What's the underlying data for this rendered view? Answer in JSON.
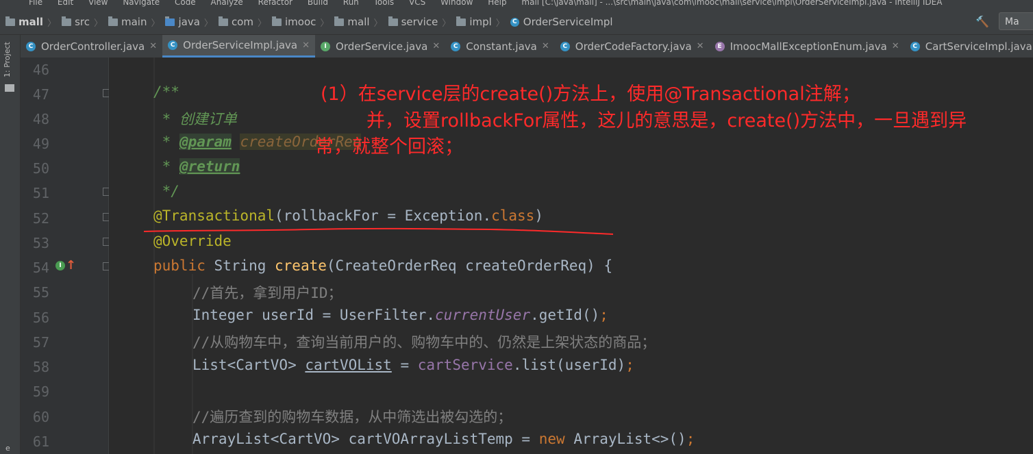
{
  "menu": [
    "File",
    "Edit",
    "View",
    "Navigate",
    "Code",
    "Analyze",
    "Refactor",
    "Build",
    "Run",
    "Tools",
    "VCS",
    "Window",
    "Help",
    "mall [C:\\java\\mall] - ...\\src\\main\\java\\com\\imooc\\mall\\service\\impl\\OrderServiceImpl.java - IntelliJ IDEA"
  ],
  "breadcrumb": [
    "mall",
    "src",
    "main",
    "java",
    "com",
    "imooc",
    "mall",
    "service",
    "impl",
    "OrderServiceImpl"
  ],
  "run_label": "Ma",
  "tabs": [
    "OrderController.java",
    "OrderServiceImpl.java",
    "OrderService.java",
    "Constant.java",
    "OrderCodeFactory.java",
    "ImoocMallExceptionEnum.java",
    "CartServiceImpl.java"
  ],
  "side_panel_label": "1: Project",
  "side_bottom_char": "e",
  "line_numbers": [
    "46",
    "47",
    "48",
    "49",
    "50",
    "51",
    "52",
    "53",
    "54",
    "55",
    "56",
    "57",
    "58",
    "59",
    "60",
    "61"
  ],
  "code": {
    "l47": "/**",
    "l48": " * 创建订单",
    "l49_tag": "@param",
    "l49_param": "createOrderReq",
    "l50_tag": "@return",
    "l51": " */",
    "l52_ann": "@Transactional",
    "l52_open": "(rollbackFor = Exception.",
    "l52_kw": "class",
    "l52_close": ")",
    "l53": "@Override",
    "l54_public": "public",
    "l54_type": " String ",
    "l54_fn": "create",
    "l54_rest": "(CreateOrderReq createOrderReq) {",
    "l55": "//首先，拿到用户ID；",
    "l56_a": "Integer userId = UserFilter.",
    "l56_fld": "currentUser",
    "l56_b": ".getId()",
    "l56_semi": ";",
    "l57": "//从购物车中，查询当前用户的、购物车中的、仍然是上架状态的商品；",
    "l58_a": "List<CartVO> ",
    "l58_var": "cartVOList",
    "l58_b": " = ",
    "l58_svc": "cartService",
    "l58_c": ".list(userId)",
    "l58_semi": ";",
    "l60": "//遍历查到的购物车数据，从中筛选出被勾选的；",
    "l61_a": "ArrayList<CartVO> cartVOArrayListTemp = ",
    "l61_new": "new",
    "l61_b": " ArrayList<>()",
    "l61_semi": ";"
  },
  "annotation": {
    "line1": "(1）在service层的create()方法上，使用@Transactional注解；",
    "line2": "并，设置rollbackFor属性，这儿的意思是，create()方法中，一旦遇到异",
    "line3": "常，就整个回滚；"
  },
  "colors": {
    "background": "#2b2b2b",
    "annotation_red": "#ff2a2a",
    "keyword": "#cc7832",
    "annotation_yellow": "#bbb529",
    "comment_green": "#629755"
  }
}
